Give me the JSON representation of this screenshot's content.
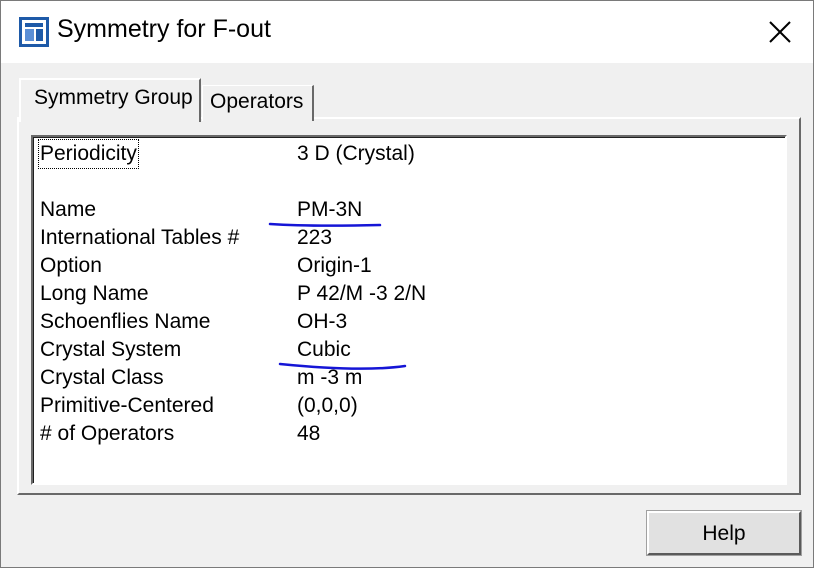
{
  "window": {
    "title": "Symmetry for F-out",
    "icon": "app-window-icon",
    "close_icon": "close-icon"
  },
  "tabs": [
    {
      "label": "Symmetry Group",
      "selected": true
    },
    {
      "label": "Operators",
      "selected": false
    }
  ],
  "properties": [
    {
      "label": "Periodicity",
      "value": "3 D (Crystal)"
    },
    {
      "label": "Name",
      "value": "PM-3N"
    },
    {
      "label": "International Tables #",
      "value": "223"
    },
    {
      "label": "Option",
      "value": "Origin-1"
    },
    {
      "label": "Long Name",
      "value": "P 42/M -3 2/N"
    },
    {
      "label": "Schoenflies Name",
      "value": "OH-3"
    },
    {
      "label": "Crystal System",
      "value": "Cubic"
    },
    {
      "label": "Crystal Class",
      "value": "m -3 m"
    },
    {
      "label": "Primitive-Centered",
      "value": "(0,0,0)"
    },
    {
      "label": "# of Operators",
      "value": "48"
    }
  ],
  "annotation_color": "#1515d6",
  "buttons": {
    "help_label": "Help"
  }
}
